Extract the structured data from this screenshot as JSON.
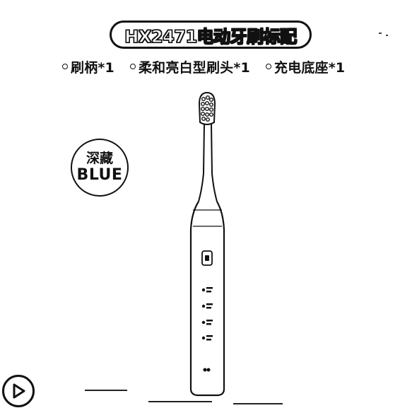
{
  "header": {
    "title": "HX2471电动牙刷标配"
  },
  "contents": {
    "items": [
      {
        "label": "刷柄*1"
      },
      {
        "label": "柔和亮白型刷头*1"
      },
      {
        "label": "充电底座*1"
      }
    ]
  },
  "color_badge": {
    "chinese": "深藏",
    "english": "BLUE"
  },
  "colors": {
    "ink": "#111111",
    "background": "#ffffff"
  },
  "icons": {
    "play": "play-icon",
    "product": "toothbrush-illustration"
  }
}
